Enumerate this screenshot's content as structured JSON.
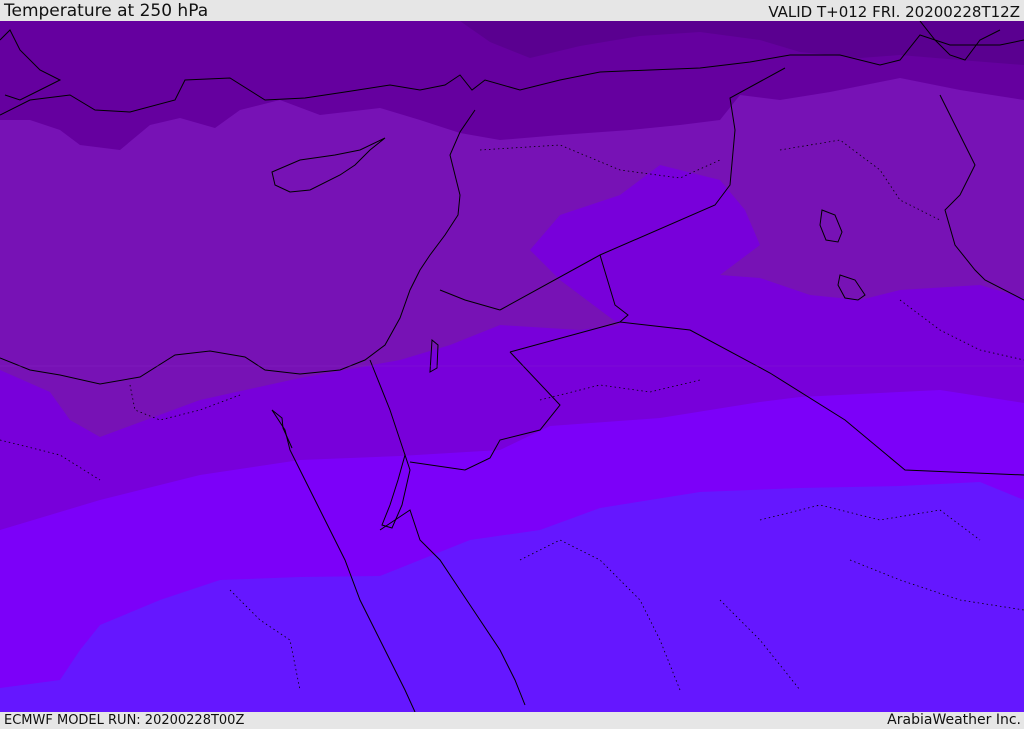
{
  "header": {
    "title": "Temperature at 250 hPa",
    "valid": "VALID T+012 FRI. 20200228T12Z"
  },
  "footer": {
    "model_run": "ECMWF MODEL RUN: 20200228T00Z",
    "credit": "ArabiaWeather Inc."
  },
  "colors": {
    "band_coldest": "#5a0090",
    "band_cold": "#65009f",
    "band_mid": "#7712b5",
    "band_warm": "#7800da",
    "band_warmer": "#7c00f9",
    "band_warmest": "#6517ff",
    "coastline": "#000000",
    "border": "#000000",
    "chrome_bg": "#e6e6e6"
  }
}
